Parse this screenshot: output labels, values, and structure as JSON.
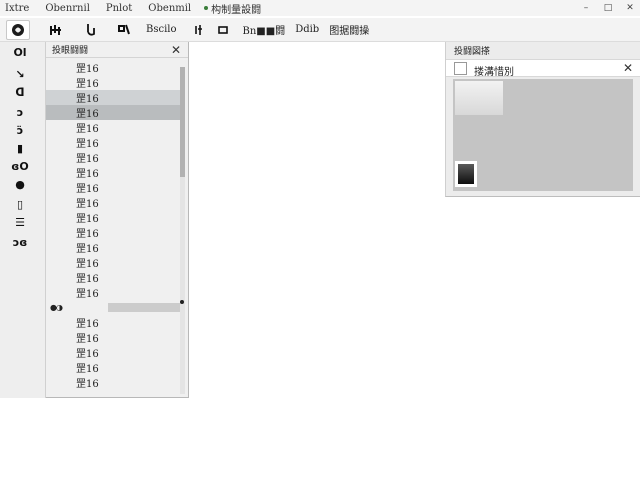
{
  "menubar": {
    "items": [
      "Ixtre",
      "Obenrnil",
      "Pnlot",
      "Obenmil"
    ],
    "title": "构制量設闘",
    "window_controls": [
      "–",
      "□",
      "✕"
    ]
  },
  "toolbar": {
    "texts": [
      "Bscilo",
      "Bn■■闘",
      "Ddib",
      "图据闘操"
    ]
  },
  "tools": [
    "Ol",
    "↘",
    "ᗡ",
    "ɔ",
    "ɔ̈",
    "▮",
    "ɞO",
    "●",
    "▯",
    "☰",
    "ɔɞ"
  ],
  "layers_panel": {
    "title": "投眼闘闘",
    "close": "✕",
    "row_label": "罡16",
    "rows_before": 16,
    "selected_rows": [
      2,
      3
    ],
    "special_row_icons": "●◑",
    "rows_after": 5
  },
  "right_panel": {
    "title": "投闘図搽",
    "sub_label": "搂溝惜別",
    "close": "✕"
  },
  "colors": {
    "selected_light": "#cfd2d4",
    "selected_dark": "#b9bcbe",
    "preview_bg": "#c4c4c4"
  }
}
